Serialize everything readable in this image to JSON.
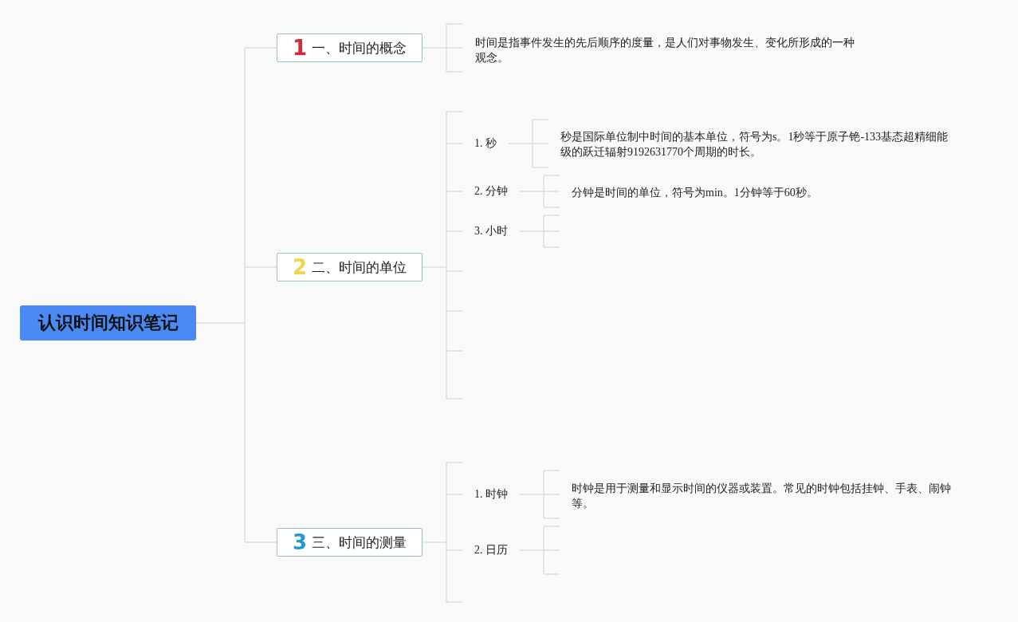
{
  "root": {
    "title": "认识时间知识笔记"
  },
  "branches": [
    {
      "number": "1",
      "color": "#d7263d",
      "title": "一、时间的概念",
      "note": "时间是指事件发生的先后顺序的度量，是人们对事物发生、变化所形成的一种观念。"
    },
    {
      "number": "2",
      "color": "#f2d24b",
      "title": "二、时间的单位",
      "subtopics": [
        {
          "label": "1. 秒",
          "note": "秒是国际单位制中时间的基本单位，符号为s。1秒等于原子铯-133基态超精细能级的跃迁辐射9192631770个周期的时长。"
        },
        {
          "label": "2. 分钟",
          "note": "分钟是时间的单位，符号为min。1分钟等于60秒。"
        },
        {
          "label": "3. 小时"
        }
      ]
    },
    {
      "number": "3",
      "color": "#1f9ad6",
      "title": "三、时间的测量",
      "subtopics": [
        {
          "label": "1. 时钟",
          "note": "时钟是用于测量和显示时间的仪器或装置。常见的时钟包括挂钟、手表、闹钟等。"
        },
        {
          "label": "2. 日历"
        }
      ]
    }
  ]
}
